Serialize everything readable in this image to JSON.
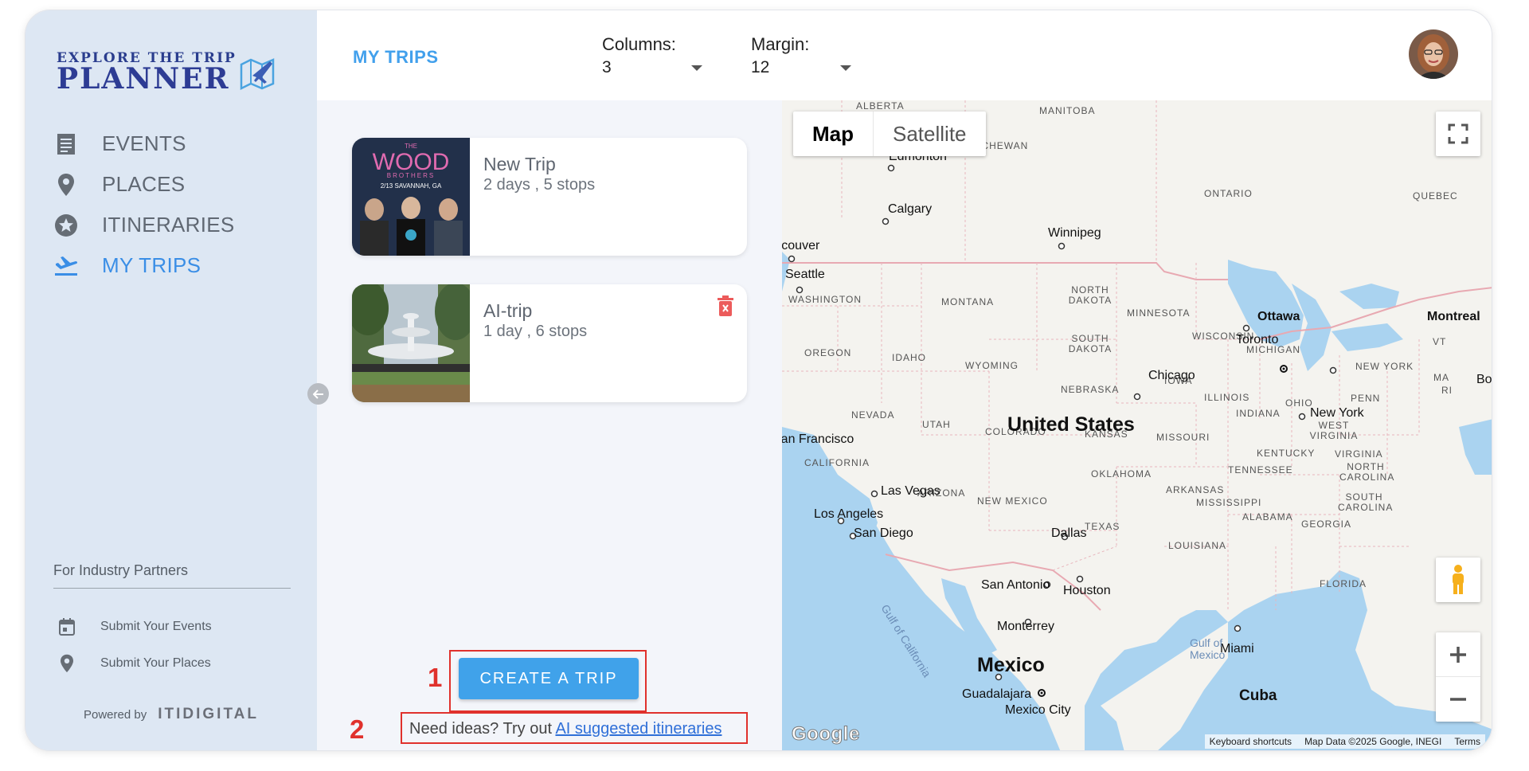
{
  "logo": {
    "line1": "EXPLORE THE TRIP",
    "line2": "PLANNER"
  },
  "nav": [
    {
      "label": "EVENTS",
      "icon": "document-icon",
      "active": false
    },
    {
      "label": "PLACES",
      "icon": "location-pin-icon",
      "active": false
    },
    {
      "label": "ITINERARIES",
      "icon": "star-icon",
      "active": false
    },
    {
      "label": "MY TRIPS",
      "icon": "airplane-icon",
      "active": true
    }
  ],
  "partners": {
    "title": "For Industry Partners",
    "items": [
      {
        "label": "Submit Your Events",
        "icon": "calendar-icon"
      },
      {
        "label": "Submit Your Places",
        "icon": "location-pin-icon"
      }
    ]
  },
  "powered": {
    "label": "Powered by",
    "brand": "ITIDIGITAL"
  },
  "topbar": {
    "title": "MY TRIPS",
    "columns": {
      "label": "Columns:",
      "value": "3"
    },
    "margin": {
      "label": "Margin:",
      "value": "12"
    }
  },
  "trips": [
    {
      "name": "New Trip",
      "meta": "2 days , 5 stops",
      "thumb_text_1": "THE",
      "thumb_text_2": "WOOD",
      "thumb_text_3": "BROTHERS",
      "thumb_text_4": "2/13 SAVANNAH, GA"
    },
    {
      "name": "AI-trip",
      "meta": "1 day , 6 stops"
    }
  ],
  "annotations": {
    "one": "1",
    "two": "2"
  },
  "create_button": "CREATE A TRIP",
  "ideas": {
    "prefix": "Need ideas? Try out ",
    "link": "AI suggested itineraries"
  },
  "map": {
    "toggle": {
      "map": "Map",
      "satellite": "Satellite"
    },
    "google": "Google",
    "footer": [
      "Keyboard shortcuts",
      "Map Data ©2025 Google, INEGI",
      "Terms"
    ],
    "country": [
      "United States",
      "Mexico"
    ],
    "cities": [
      "Edmonton",
      "Calgary",
      "Winnipeg",
      "Vancouver",
      "Seattle",
      "Ottawa",
      "Montreal",
      "Toronto",
      "Chicago",
      "New York",
      "San Francisco",
      "Las Vegas",
      "Los Angeles",
      "San Diego",
      "Dallas",
      "San Antonio",
      "Houston",
      "Monterrey",
      "Miami",
      "Guadalajara",
      "Mexico City",
      "Cuba",
      "Bo"
    ],
    "regions": [
      "ALBERTA",
      "MANITOBA",
      "SASKATCHEWAN",
      "ONTARIO",
      "QUEBEC",
      "WASHINGTON",
      "MONTANA",
      "NORTH DAKOTA",
      "MINNESOTA",
      "OREGON",
      "IDAHO",
      "SOUTH DAKOTA",
      "WISCONSIN",
      "MICHIGAN",
      "WYOMING",
      "IOWA",
      "NEW YORK",
      "NEBRASKA",
      "ILLINOIS",
      "OHIO",
      "PENN",
      "NEVADA",
      "UTAH",
      "COLORADO",
      "KANSAS",
      "MISSOURI",
      "INDIANA",
      "WEST VIRGINIA",
      "VIRGINIA",
      "KENTUCKY",
      "CALIFORNIA",
      "OKLAHOMA",
      "TENNESSEE",
      "NORTH CAROLINA",
      "ARIZONA",
      "NEW MEXICO",
      "ARKANSAS",
      "MISSISSIPPI",
      "SOUTH CAROLINA",
      "ALABAMA",
      "GEORGIA",
      "TEXAS",
      "LOUISIANA",
      "FLORIDA",
      "VT",
      "MA",
      "RI"
    ],
    "water": [
      "Gulf of California",
      "Gulf of",
      "Mexico"
    ]
  }
}
